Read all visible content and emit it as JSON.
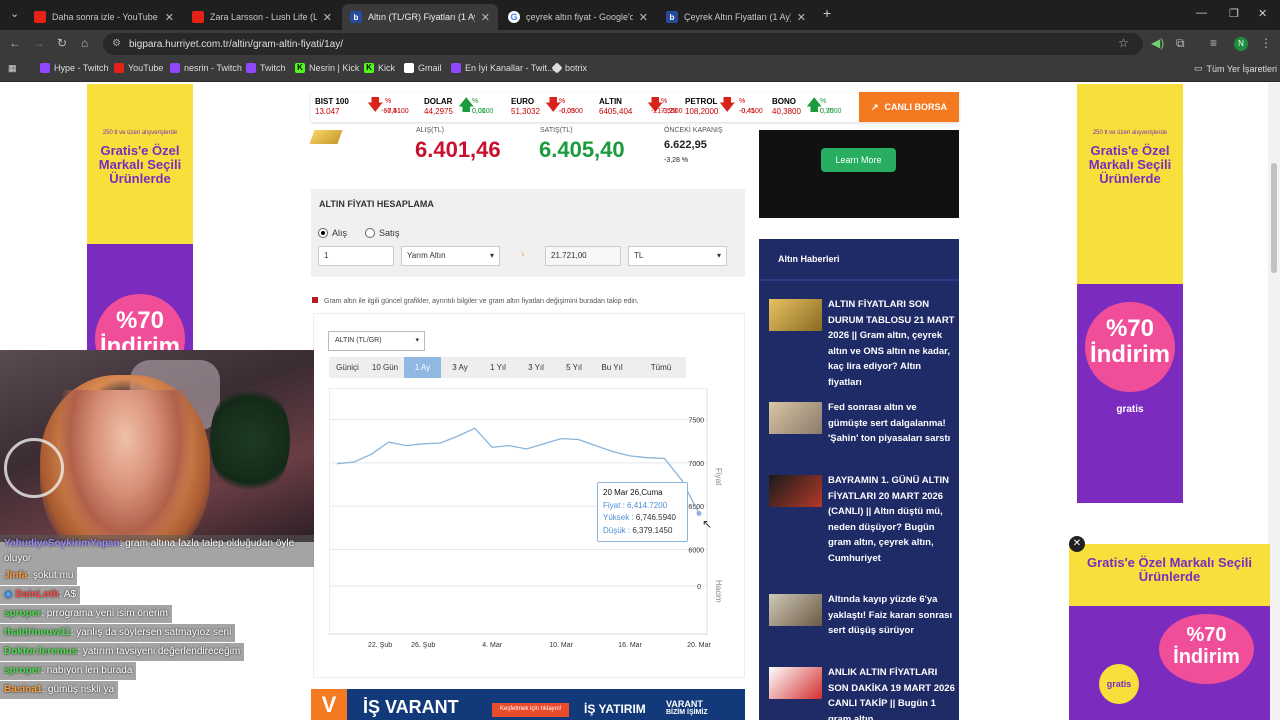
{
  "tabs": [
    {
      "title": "Daha sonra izle - YouTube",
      "icon": "youtube-icon"
    },
    {
      "title": "Zara Larsson - Lush Life (Lyrics)",
      "icon": "youtube-icon"
    },
    {
      "title": "Altın (TL/GR) Fiyatları (1 Ay) - A",
      "icon": "hurriyet-icon"
    },
    {
      "title": "çeyrek altın fiyat - Google'da A",
      "icon": "google-icon"
    },
    {
      "title": "Çeyrek Altın Fiyatları (1 Ay) - Ç",
      "icon": "hurriyet-icon"
    }
  ],
  "address": {
    "url": "bigpara.hurriyet.com.tr/altin/gram-altin-fiyati/1ay/"
  },
  "profile_initial": "N",
  "bookmarks": [
    "Hype - Twitch",
    "YouTube",
    "nesrin - Twitch",
    "Twitch",
    "Nesrin | Kick",
    "Kick",
    "Gmail",
    "En İyi Kanallar - Twit...",
    "botrix"
  ],
  "all_bookmarks": "Tüm Yer İşaretleri",
  "market": [
    {
      "name": "BIST 100",
      "value": "13.047",
      "pct": "% -0,51",
      "chg": "-67,4100",
      "dir": "down"
    },
    {
      "name": "DOLAR",
      "value": "44,2975",
      "pct": "% 0,01",
      "chg": "0,0000",
      "dir": "up"
    },
    {
      "name": "EURO",
      "value": "51,3032",
      "pct": "% -0,05",
      "chg": "-0,0300",
      "dir": "down"
    },
    {
      "name": "ALTIN",
      "value": "6405,404",
      "pct": "% -3,28",
      "chg": "-217,5500",
      "dir": "down"
    },
    {
      "name": "PETROL",
      "value": "108,2000",
      "pct": "% -0,41",
      "chg": "-0,4500",
      "dir": "down"
    },
    {
      "name": "BONO",
      "value": "40,3800",
      "pct": "% 0,75",
      "chg": "0,3000",
      "dir": "up"
    }
  ],
  "canli_borsa": "CANLI BORSA",
  "prices": {
    "buy_label": "ALIŞ(TL)",
    "buy": "6.401,46",
    "sell_label": "SATIŞ(TL)",
    "sell": "6.405,40",
    "prev_label": "ÖNCEKİ KAPANIŞ",
    "prev": "6.622,95",
    "prev_pct": "-3,28 %"
  },
  "calc": {
    "title": "ALTIN FİYATI HESAPLAMA",
    "alis": "Alış",
    "satis": "Satış",
    "qty": "1",
    "type": "Yarım Altın",
    "result": "21.721,00",
    "currency": "TL"
  },
  "note": "Gram altın ile ilgili güncel grafikler, ayrıntılı bilgiler ve gram altın fiyatları değişimini buradan takip edin.",
  "chart_select": "ALTIN (TL/GR)",
  "ranges": [
    "Güniçi",
    "10 Gün",
    "1 Ay",
    "3 Ay",
    "1 Yıl",
    "3 Yıl",
    "5 Yıl",
    "Bu Yıl",
    "Tümü"
  ],
  "active_range": "1 Ay",
  "chart_data": {
    "type": "line",
    "x": [
      "19 Şub",
      "20 Şub",
      "23 Şub",
      "24 Şub",
      "25 Şub",
      "26 Şub",
      "27 Şub",
      "2 Mar",
      "3 Mar",
      "4 Mar",
      "5 Mar",
      "6 Mar",
      "9 Mar",
      "10 Mar",
      "11 Mar",
      "12 Mar",
      "13 Mar",
      "16 Mar",
      "17 Mar",
      "18 Mar",
      "19 Mar",
      "20 Mar"
    ],
    "series": [
      {
        "name": "Fiyat",
        "values": [
          6990,
          7010,
          7100,
          7240,
          7200,
          7220,
          7230,
          7310,
          7400,
          7180,
          7200,
          7160,
          7220,
          7280,
          7270,
          7200,
          7130,
          7080,
          7060,
          7050,
          6800,
          6414.72
        ]
      }
    ],
    "xticks": [
      "22. Şub",
      "26. Şub",
      "4. Mar",
      "10. Mar",
      "16. Mar",
      "20. Mar"
    ],
    "yticks": [
      "7500",
      "7000",
      "6500",
      "6000"
    ],
    "volume_ticks": [
      "0"
    ],
    "ylabel": "Fiyat",
    "y2label": "Hacim",
    "ylim": [
      5900,
      7750
    ],
    "tooltip": {
      "date": "20 Mar 26,Cuma",
      "fiyat_label": "Fiyat",
      "fiyat": "6,414.7200",
      "yuksek_label": "Yüksek",
      "yuksek": "6,746.5940",
      "dusuk_label": "Düşük",
      "dusuk": "6,379.1450"
    }
  },
  "learn_more": "Learn More",
  "news": {
    "title": "Altın Haberleri",
    "items": [
      "ALTIN FİYATLARI SON DURUM TABLOSU 21 MART 2026 || Gram altın, çeyrek altın ve ONS altın ne kadar, kaç lira ediyor? Altın fiyatları",
      "Fed sonrası altın ve gümüşte sert dalgalanma! 'Şahin' ton piyasaları sarstı",
      "BAYRAMIN 1. GÜNÜ ALTIN FİYATLARI 20 MART 2026 (CANLI) || Altın düştü mü, neden düşüyor? Bugün gram altın, çeyrek altın, Cumhuriyet",
      "Altında kayıp yüzde 6'ya yaklaştı! Faiz kararı sonrası sert düşüş sürüyor",
      "ANLIK ALTIN FİYATLARI SON DAKİKA 19 MART 2026 CANLI TAKİP || Bugün 1 gram altın"
    ]
  },
  "ad": {
    "small": "250 tl ve üzeri alışverişlerde",
    "headline": "Gratis'e Özel Markalı Seçili Ürünlerde",
    "discount": "%70 İndirim",
    "brand": "gratis"
  },
  "varant": {
    "brand": "İŞ VARANT",
    "cta": "Keşfetmek için tıklayın!",
    "bank": "İŞ YATIRIM",
    "tag": "VARANT",
    "tag2": "BİZİM İŞİMİZ"
  },
  "chat": [
    {
      "user": "YahudiyeSoykirimYapan",
      "msg": ": gram altına fazla talep olduğudan öyle oluyor",
      "color": "#9b8cff"
    },
    {
      "user": "Jinfa",
      "msg": ": şokut mu",
      "color": "#ff9c3a"
    },
    {
      "user": "DainLoth",
      "msg": ": A$",
      "color": "#ff4d4d"
    },
    {
      "user": "sproper",
      "msg": ": prrograma yeni isim önerim",
      "color": "#4dde4d"
    },
    {
      "user": "thaldrineuw11",
      "msg": ": yanlış da söylersen satmayıoz seni",
      "color": "#4dde4d"
    },
    {
      "user": "DoktorJeremus",
      "msg": ": yatırım tavsiyeni değerlendireceğim",
      "color": "#4dde4d"
    },
    {
      "user": "sproper",
      "msg": ": nabıyon len burada",
      "color": "#4dde4d"
    },
    {
      "user": "Basina1",
      "msg": ": gümüş riskli ya",
      "color": "#ff9c3a"
    }
  ]
}
